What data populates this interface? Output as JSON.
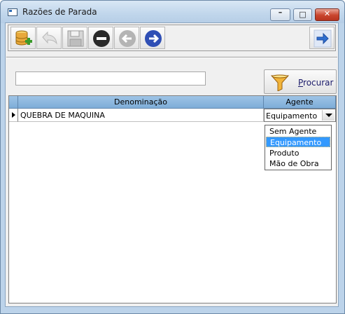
{
  "window": {
    "title": "Razões de Parada",
    "controls": {
      "minimize": "–",
      "maximize": "□",
      "close": "✕"
    }
  },
  "toolbar": {
    "buttons": [
      {
        "name": "new-record",
        "icon": "database-add-icon",
        "enabled": true
      },
      {
        "name": "undo",
        "icon": "undo-arrow-icon",
        "enabled": false
      },
      {
        "name": "save",
        "icon": "floppy-disk-icon",
        "enabled": false
      },
      {
        "name": "delete",
        "icon": "minus-circle-icon",
        "enabled": true
      },
      {
        "name": "previous",
        "icon": "left-arrow-circle-icon",
        "enabled": false
      },
      {
        "name": "next",
        "icon": "right-arrow-circle-icon",
        "enabled": true
      },
      {
        "name": "exit",
        "icon": "exit-arrow-icon",
        "enabled": true
      }
    ]
  },
  "search": {
    "value": "",
    "button_label": "Procurar",
    "button_icon": "funnel-icon"
  },
  "grid": {
    "columns": [
      "Denominação",
      "Agente"
    ],
    "rows": [
      {
        "denominacao": "QUEBRA DE MAQUINA",
        "agente": "Equipamento"
      }
    ]
  },
  "agente_dropdown": {
    "options": [
      "Sem Agente",
      "Equipamento",
      "Produto",
      "Mão de Obra"
    ],
    "selected": "Equipamento"
  },
  "colors": {
    "header": "#8db8df",
    "selection": "#3399ff"
  }
}
